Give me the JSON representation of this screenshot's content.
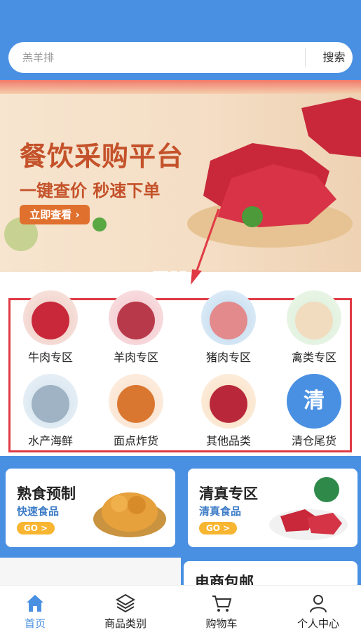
{
  "search": {
    "placeholder": "羔羊排",
    "button": "搜索"
  },
  "banner": {
    "title": "餐饮采购平台",
    "subtitle": "一键查价 秒速下单",
    "button": "立即查看 ›"
  },
  "categories": [
    {
      "label": "牛肉专区",
      "icon": "beef-image"
    },
    {
      "label": "羊肉专区",
      "icon": "lamb-image"
    },
    {
      "label": "猪肉专区",
      "icon": "pork-image"
    },
    {
      "label": "禽类专区",
      "icon": "poultry-image"
    },
    {
      "label": "水产海鲜",
      "icon": "seafood-image"
    },
    {
      "label": "面点炸货",
      "icon": "fried-snacks-image"
    },
    {
      "label": "其他品类",
      "icon": "other-meat-image"
    },
    {
      "label": "清仓尾货",
      "icon_text": "清"
    }
  ],
  "promos": [
    {
      "title": "熟食预制",
      "subtitle": "快速食品",
      "button": "GO >"
    },
    {
      "title": "清真专区",
      "subtitle": "清真食品",
      "button": "GO >"
    },
    {
      "title": "电商包邮"
    }
  ],
  "tabbar": [
    {
      "label": "首页",
      "icon": "home-icon",
      "active": true
    },
    {
      "label": "商品类别",
      "icon": "layers-icon"
    },
    {
      "label": "购物车",
      "icon": "cart-icon"
    },
    {
      "label": "个人中心",
      "icon": "user-icon"
    }
  ],
  "colors": {
    "primary": "#4a90e2",
    "highlight_border": "#e03a44",
    "banner_text": "#c4522a",
    "go_button": "#f8b531"
  }
}
